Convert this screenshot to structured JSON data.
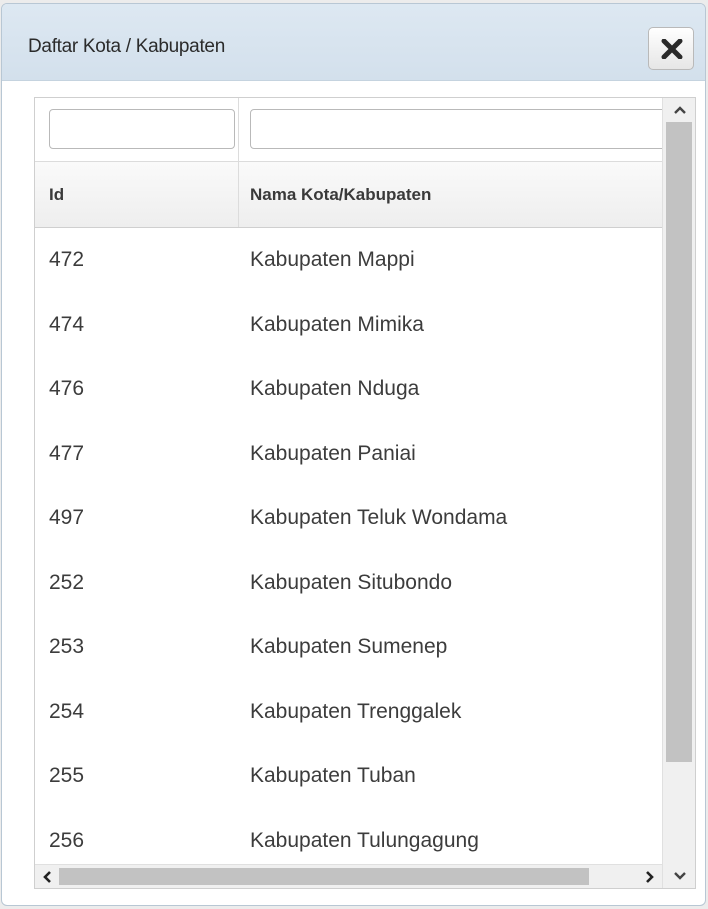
{
  "dialog": {
    "title": "Daftar Kota / Kabupaten",
    "close_icon": "close-x-icon"
  },
  "filters": {
    "id_value": "",
    "name_value": ""
  },
  "columns": [
    "Id",
    "Nama Kota/Kabupaten"
  ],
  "rows": [
    {
      "id": "472",
      "name": "Kabupaten Mappi"
    },
    {
      "id": "474",
      "name": "Kabupaten Mimika"
    },
    {
      "id": "476",
      "name": "Kabupaten Nduga"
    },
    {
      "id": "477",
      "name": "Kabupaten Paniai"
    },
    {
      "id": "497",
      "name": "Kabupaten Teluk Wondama"
    },
    {
      "id": "252",
      "name": "Kabupaten Situbondo"
    },
    {
      "id": "253",
      "name": "Kabupaten Sumenep"
    },
    {
      "id": "254",
      "name": "Kabupaten Trenggalek"
    },
    {
      "id": "255",
      "name": "Kabupaten Tuban"
    },
    {
      "id": "256",
      "name": "Kabupaten Tulungagung"
    }
  ],
  "icons": {
    "scroll_up": "chevron-up-icon",
    "scroll_down": "chevron-down-icon",
    "scroll_left": "chevron-left-icon",
    "scroll_right": "chevron-right-icon"
  },
  "colors": {
    "titlebar": "#d7e3ee",
    "border": "#b8c7d4",
    "text": "#3c3c3c"
  }
}
